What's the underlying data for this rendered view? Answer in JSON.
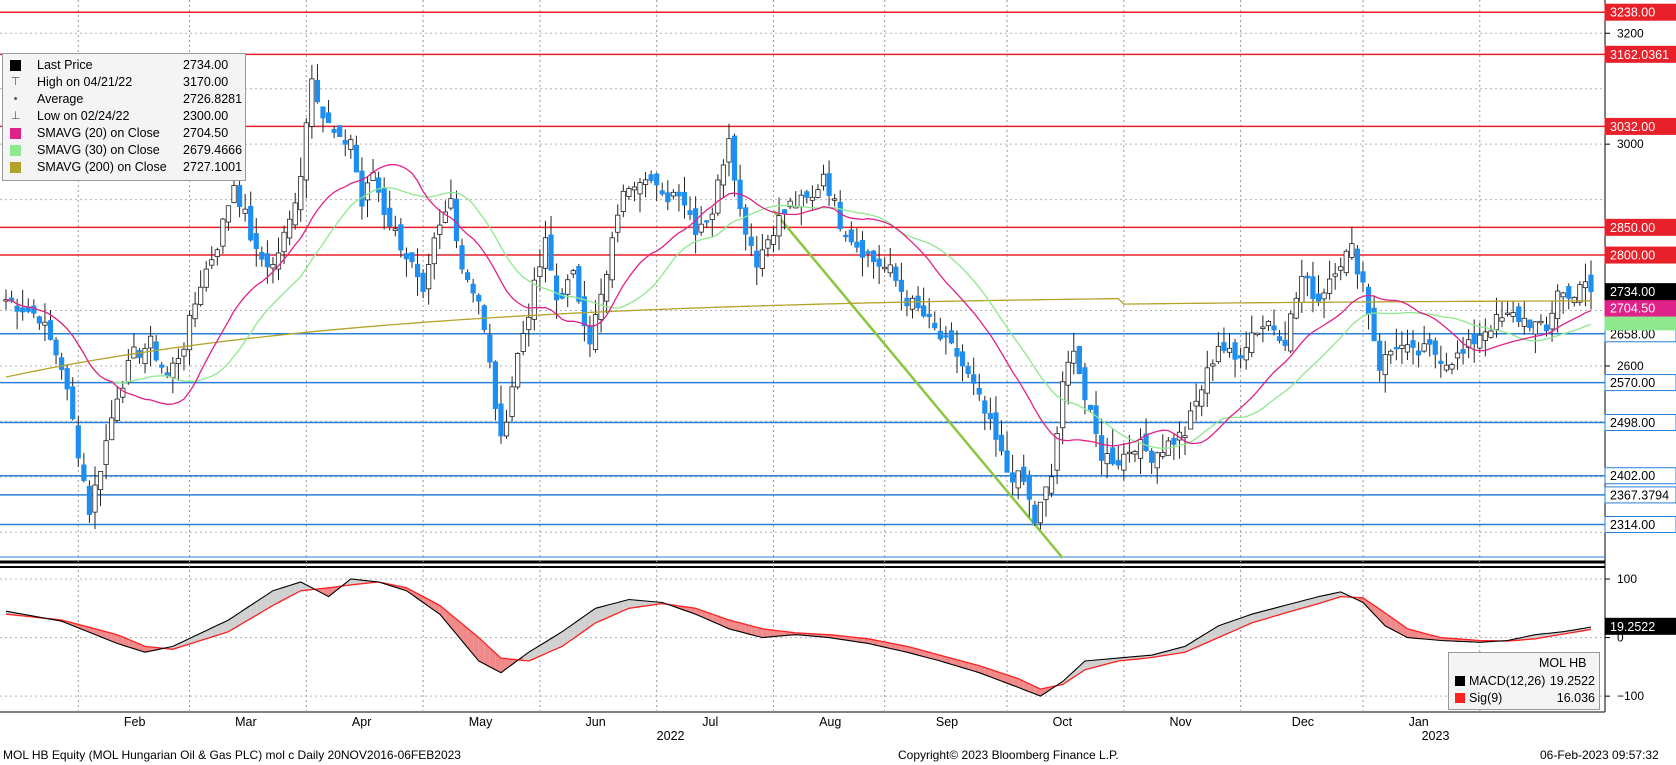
{
  "footer": {
    "left": "MOL HB Equity (MOL Hungarian Oil & Gas PLC) mol c  Daily 20NOV2016-06FEB2023",
    "center": "Copyright© 2023 Bloomberg Finance L.P.",
    "right": "06-Feb-2023 09:57:32"
  },
  "legend": [
    {
      "icon": "square-black",
      "label": "Last Price",
      "value": "2734.00",
      "color": "#000000"
    },
    {
      "icon": "high-marker-icon",
      "label": "High on 04/21/22",
      "value": "3170.00"
    },
    {
      "icon": "average-marker-icon",
      "label": "Average",
      "value": "2726.8281"
    },
    {
      "icon": "low-marker-icon",
      "label": "Low on 02/24/22",
      "value": "2300.00"
    },
    {
      "icon": "square-magenta",
      "label": "SMAVG (20)  on Close",
      "value": "2704.50",
      "color": "#e0218a"
    },
    {
      "icon": "square-lightgreen",
      "label": "SMAVG (30)  on Close",
      "value": "2679.4666",
      "color": "#8ee88e"
    },
    {
      "icon": "square-olive",
      "label": "SMAVG (200)  on Close",
      "value": "2727.1001",
      "color": "#b3a32a"
    }
  ],
  "macd_legend": {
    "title": "MOL HB",
    "rows": [
      {
        "label": "MACD(12,26)",
        "value": "19.2522",
        "color": "#000000"
      },
      {
        "label": "Sig(9)",
        "value": "16.036",
        "color": "#ff2020"
      }
    ]
  },
  "chart_data": [
    {
      "type": "candlestick",
      "y_ticks": [
        3200,
        3000,
        2800,
        2600
      ],
      "ylim": [
        2250,
        3260
      ],
      "x_months": [
        "Feb",
        "Mar",
        "Apr",
        "May",
        "Jun",
        "Jul",
        "Aug",
        "Sep",
        "Oct",
        "Nov",
        "Dec",
        "Jan"
      ],
      "x_years": [
        "2022",
        "2023"
      ],
      "resistance_levels": [
        3238.0,
        3162.0361,
        3032.0,
        2850.0,
        2800.0
      ],
      "resistance_labels": [
        "3238.00",
        "3162.0361",
        "3032.00",
        "2850.00",
        "2800.00"
      ],
      "support_levels": [
        2658.0,
        2570.0,
        2498.0,
        2402.0,
        2367.3794,
        2314.0
      ],
      "support_labels": [
        "2658.00",
        "2570.00",
        "2498.00",
        "2402.00",
        "2367.3794",
        "2314.00"
      ],
      "last_price": 2734.0,
      "last_price_label": "2734.00",
      "sma20_last": 2704.5,
      "sma20_label": "2704.50",
      "sma30_last": 2679.4666,
      "close_anchors": [
        [
          0,
          2720
        ],
        [
          3,
          2705
        ],
        [
          6,
          2690
        ],
        [
          10,
          2600
        ],
        [
          12,
          2500
        ],
        [
          15,
          2340
        ],
        [
          17,
          2420
        ],
        [
          20,
          2550
        ],
        [
          23,
          2620
        ],
        [
          26,
          2640
        ],
        [
          29,
          2580
        ],
        [
          32,
          2640
        ],
        [
          35,
          2750
        ],
        [
          38,
          2820
        ],
        [
          41,
          2930
        ],
        [
          43,
          2870
        ],
        [
          45,
          2800
        ],
        [
          48,
          2780
        ],
        [
          51,
          2860
        ],
        [
          53,
          2950
        ],
        [
          55,
          3130
        ],
        [
          57,
          3050
        ],
        [
          60,
          3000
        ],
        [
          62,
          3010
        ],
        [
          64,
          2890
        ],
        [
          66,
          2950
        ],
        [
          68,
          2880
        ],
        [
          70,
          2840
        ],
        [
          73,
          2780
        ],
        [
          75,
          2720
        ],
        [
          77,
          2820
        ],
        [
          80,
          2900
        ],
        [
          82,
          2780
        ],
        [
          85,
          2720
        ],
        [
          87,
          2600
        ],
        [
          89,
          2460
        ],
        [
          92,
          2620
        ],
        [
          94,
          2700
        ],
        [
          97,
          2820
        ],
        [
          99,
          2720
        ],
        [
          102,
          2760
        ],
        [
          105,
          2650
        ],
        [
          108,
          2760
        ],
        [
          110,
          2880
        ],
        [
          112,
          2930
        ],
        [
          115,
          2950
        ],
        [
          118,
          2900
        ],
        [
          121,
          2920
        ],
        [
          124,
          2850
        ],
        [
          127,
          2880
        ],
        [
          130,
          3020
        ],
        [
          132,
          2880
        ],
        [
          135,
          2790
        ],
        [
          138,
          2850
        ],
        [
          141,
          2890
        ],
        [
          145,
          2900
        ],
        [
          147,
          2950
        ],
        [
          150,
          2860
        ],
        [
          153,
          2820
        ],
        [
          156,
          2790
        ],
        [
          159,
          2770
        ],
        [
          162,
          2720
        ],
        [
          165,
          2690
        ],
        [
          168,
          2650
        ],
        [
          171,
          2620
        ],
        [
          174,
          2560
        ],
        [
          177,
          2490
        ],
        [
          180,
          2410
        ],
        [
          183,
          2390
        ],
        [
          185,
          2320
        ],
        [
          188,
          2400
        ],
        [
          190,
          2560
        ],
        [
          192,
          2640
        ],
        [
          194,
          2540
        ],
        [
          197,
          2440
        ],
        [
          200,
          2430
        ],
        [
          203,
          2460
        ],
        [
          206,
          2440
        ],
        [
          209,
          2460
        ],
        [
          212,
          2480
        ],
        [
          215,
          2560
        ],
        [
          218,
          2640
        ],
        [
          221,
          2610
        ],
        [
          224,
          2660
        ],
        [
          227,
          2680
        ],
        [
          230,
          2650
        ],
        [
          233,
          2760
        ],
        [
          236,
          2720
        ],
        [
          239,
          2780
        ],
        [
          242,
          2810
        ],
        [
          244,
          2750
        ],
        [
          247,
          2600
        ],
        [
          250,
          2640
        ],
        [
          253,
          2620
        ],
        [
          256,
          2630
        ],
        [
          259,
          2610
        ],
        [
          262,
          2620
        ],
        [
          265,
          2660
        ],
        [
          268,
          2680
        ],
        [
          271,
          2690
        ],
        [
          274,
          2680
        ],
        [
          277,
          2660
        ],
        [
          279,
          2740
        ],
        [
          281,
          2720
        ],
        [
          283,
          2750
        ],
        [
          285,
          2734
        ]
      ]
    },
    {
      "type": "line",
      "y_ticks": [
        100,
        0,
        -100
      ],
      "ylim": [
        -110,
        112
      ],
      "series": [
        {
          "name": "MACD(12,26)",
          "last": 19.2522,
          "last_label": "19.2522",
          "values": [
            [
              0,
              45
            ],
            [
              10,
              28
            ],
            [
              20,
              -10
            ],
            [
              25,
              -25
            ],
            [
              30,
              -15
            ],
            [
              40,
              30
            ],
            [
              48,
              80
            ],
            [
              53,
              95
            ],
            [
              58,
              70
            ],
            [
              62,
              100
            ],
            [
              67,
              95
            ],
            [
              72,
              80
            ],
            [
              78,
              40
            ],
            [
              85,
              -40
            ],
            [
              89,
              -60
            ],
            [
              94,
              -25
            ],
            [
              100,
              10
            ],
            [
              106,
              50
            ],
            [
              112,
              65
            ],
            [
              118,
              60
            ],
            [
              124,
              40
            ],
            [
              130,
              15
            ],
            [
              136,
              0
            ],
            [
              142,
              5
            ],
            [
              148,
              0
            ],
            [
              155,
              -10
            ],
            [
              162,
              -25
            ],
            [
              168,
              -40
            ],
            [
              175,
              -60
            ],
            [
              182,
              -85
            ],
            [
              186,
              -100
            ],
            [
              190,
              -75
            ],
            [
              194,
              -40
            ],
            [
              200,
              -35
            ],
            [
              206,
              -30
            ],
            [
              212,
              -15
            ],
            [
              218,
              20
            ],
            [
              224,
              40
            ],
            [
              230,
              55
            ],
            [
              236,
              70
            ],
            [
              240,
              78
            ],
            [
              244,
              60
            ],
            [
              248,
              20
            ],
            [
              252,
              0
            ],
            [
              258,
              -5
            ],
            [
              265,
              -8
            ],
            [
              270,
              -5
            ],
            [
              275,
              5
            ],
            [
              280,
              10
            ],
            [
              285,
              18
            ]
          ]
        },
        {
          "name": "Sig(9)",
          "last": 16.036,
          "values": [
            [
              0,
              40
            ],
            [
              10,
              30
            ],
            [
              20,
              5
            ],
            [
              25,
              -15
            ],
            [
              30,
              -20
            ],
            [
              40,
              10
            ],
            [
              48,
              55
            ],
            [
              53,
              80
            ],
            [
              58,
              85
            ],
            [
              62,
              90
            ],
            [
              67,
              95
            ],
            [
              72,
              85
            ],
            [
              78,
              55
            ],
            [
              85,
              0
            ],
            [
              89,
              -35
            ],
            [
              94,
              -40
            ],
            [
              100,
              -15
            ],
            [
              106,
              25
            ],
            [
              112,
              50
            ],
            [
              118,
              58
            ],
            [
              124,
              50
            ],
            [
              130,
              30
            ],
            [
              136,
              15
            ],
            [
              142,
              8
            ],
            [
              148,
              5
            ],
            [
              155,
              -2
            ],
            [
              162,
              -15
            ],
            [
              168,
              -30
            ],
            [
              175,
              -48
            ],
            [
              182,
              -70
            ],
            [
              186,
              -88
            ],
            [
              190,
              -80
            ],
            [
              194,
              -55
            ],
            [
              200,
              -40
            ],
            [
              206,
              -34
            ],
            [
              212,
              -25
            ],
            [
              218,
              0
            ],
            [
              224,
              25
            ],
            [
              230,
              42
            ],
            [
              236,
              58
            ],
            [
              240,
              70
            ],
            [
              244,
              68
            ],
            [
              248,
              42
            ],
            [
              252,
              15
            ],
            [
              258,
              0
            ],
            [
              265,
              -5
            ],
            [
              270,
              -6
            ],
            [
              275,
              -2
            ],
            [
              280,
              6
            ],
            [
              285,
              14
            ]
          ]
        }
      ]
    }
  ]
}
